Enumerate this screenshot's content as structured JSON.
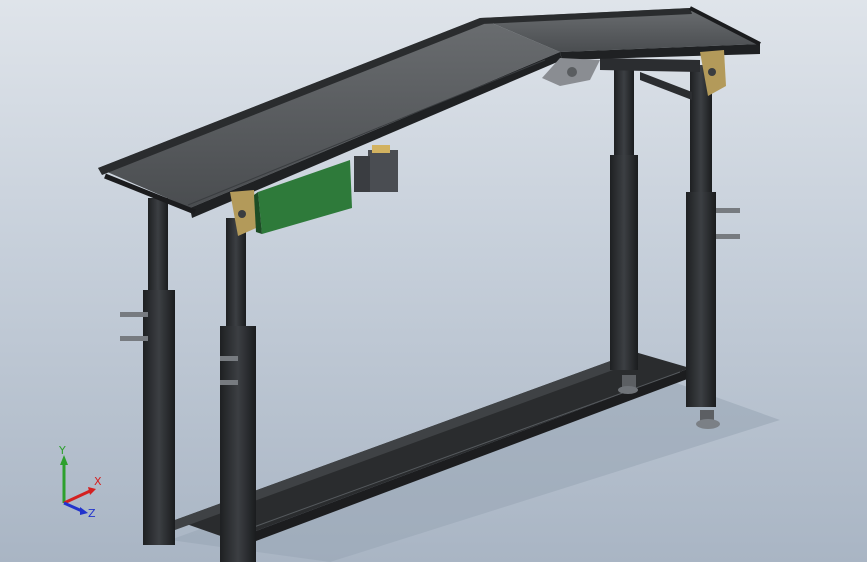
{
  "triad": {
    "x_label": "X",
    "y_label": "Y",
    "z_label": "Z",
    "x_color": "#d42020",
    "y_color": "#2da02d",
    "z_color": "#2233cc"
  },
  "colors": {
    "background_top": "#dfe4ea",
    "background_bottom": "#a9b5c4",
    "frame": "#2e3033",
    "belt": "#5a5d60",
    "control_box": "#2e7a3a",
    "bracket": "#b39a5a"
  }
}
